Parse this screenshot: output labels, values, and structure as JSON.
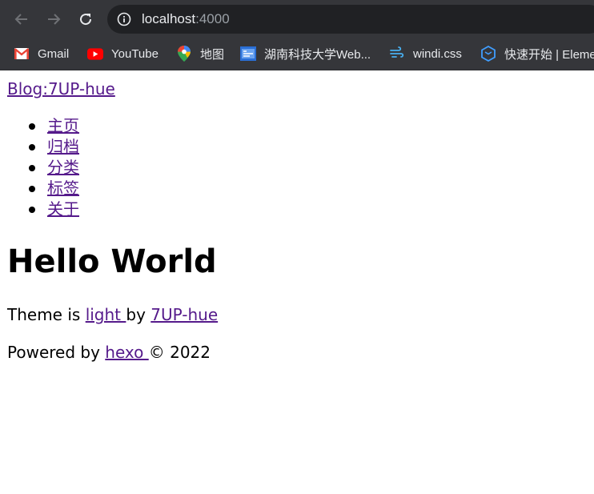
{
  "browser": {
    "url_host": "localhost",
    "url_port": ":4000",
    "bookmarks": [
      {
        "label": "Gmail",
        "icon": "gmail-icon"
      },
      {
        "label": "YouTube",
        "icon": "youtube-icon"
      },
      {
        "label": "地图",
        "icon": "maps-pin-icon"
      },
      {
        "label": "湖南科技大学Web...",
        "icon": "university-icon"
      },
      {
        "label": "windi.css",
        "icon": "windi-icon"
      },
      {
        "label": "快速开始 | Eleme",
        "icon": "element-icon"
      }
    ]
  },
  "page": {
    "blog_title": "Blog:7UP-hue",
    "menu": [
      "主页",
      "归档",
      "分类",
      "标签",
      "关于"
    ],
    "post_title": "Hello World",
    "theme_prefix": "Theme is ",
    "theme_name": "light ",
    "theme_by": "by ",
    "theme_author": "7UP-hue",
    "powered_prefix": "Powered by ",
    "powered_link": "hexo ",
    "powered_suffix": "© 2022"
  },
  "colors": {
    "chrome_bg": "#35363a",
    "omnibox_bg": "#202124",
    "link": "#551a8b"
  }
}
